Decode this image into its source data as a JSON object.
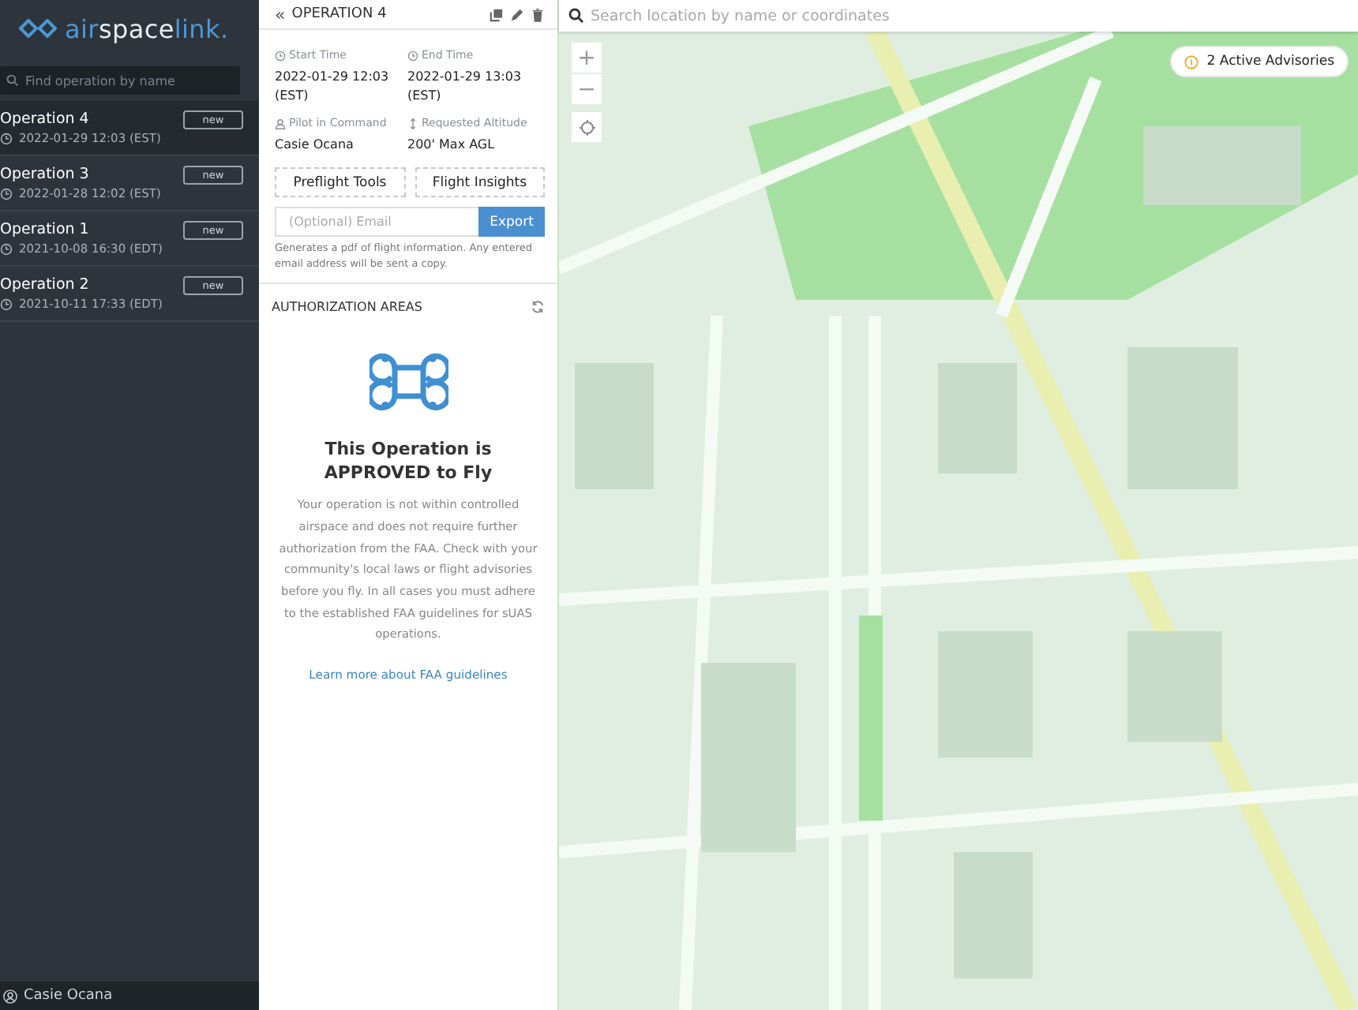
{
  "sidebar": {
    "logo": [
      {
        "text": "air",
        "kind": "accent"
      },
      {
        "text": "space",
        "kind": "plain"
      },
      {
        "text": "link.",
        "kind": "accent"
      }
    ],
    "search": {
      "placeholder": "Find operation by name"
    },
    "operations": [
      {
        "name": "Operation 4",
        "time": "2022-01-29 12:03 (EST)",
        "badge": "new",
        "selected": true
      },
      {
        "name": "Operation 3",
        "time": "2022-01-28 12:02 (EST)",
        "badge": "new",
        "selected": false
      },
      {
        "name": "Operation 1",
        "time": "2021-10-08 16:30 (EDT)",
        "badge": "new",
        "selected": false
      },
      {
        "name": "Operation 2",
        "time": "2021-10-11 17:33 (EDT)",
        "badge": "new",
        "selected": false
      }
    ],
    "user": "Casie Ocana"
  },
  "panel": {
    "back": "«",
    "title": "OPERATION 4",
    "fields": [
      {
        "kind": "time",
        "label": "Start Time",
        "value": "2022-01-29 12:03 (EST)"
      },
      {
        "kind": "time",
        "label": "End Time",
        "value": "2022-01-29 13:03 (EST)"
      },
      {
        "kind": "pilot",
        "label": "Pilot in Command",
        "value": "Casie Ocana"
      },
      {
        "kind": "altitude",
        "label": "Requested Altitude",
        "value": "200' Max AGL"
      }
    ],
    "buttons": [
      "Preflight Tools",
      "Flight Insights"
    ],
    "email": {
      "placeholder": "(Optional) Email",
      "button": "Export",
      "note": "Generates a pdf of flight information. Any entered email address will be sent a copy."
    },
    "section": "AUTHORIZATION AREAS",
    "status_title": [
      "This Operation is",
      "APPROVED to Fly"
    ],
    "status_text": "Your operation is not within controlled airspace and does not require further authorization from the FAA. Check with your community's local laws or flight advisories before you fly. In all cases you must adhere to the established FAA guidelines for sUAS operations.",
    "link": "Learn more about FAA guidelines"
  },
  "map": {
    "search": {
      "placeholder": "Search location by name or coordinates"
    },
    "zoom_in": "+",
    "zoom_out": "−",
    "advisories": "2 Active Advisories"
  }
}
